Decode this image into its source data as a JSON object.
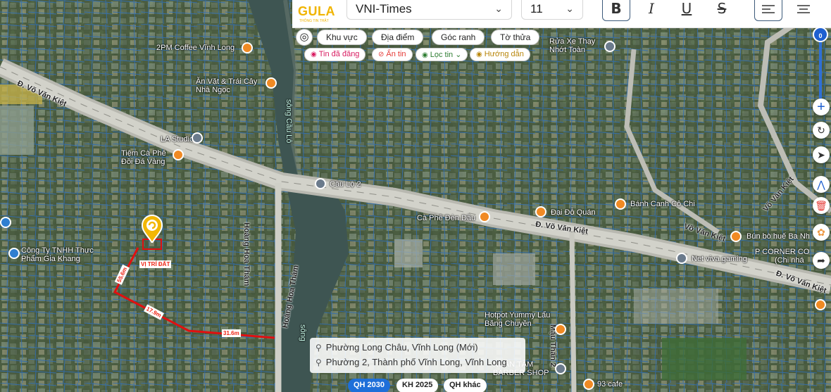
{
  "toolbar": {
    "logo_text": "GULA",
    "logo_sub": "THÔNG TIN THẬT",
    "font_family_value": "VNI-Times",
    "font_size_value": "11",
    "bold_label": "B",
    "italic_label": "I",
    "underline_label": "U",
    "strike_label": "S"
  },
  "map_tabs": [
    "Khu vực",
    "Địa điểm",
    "Góc ranh",
    "Tờ thửa"
  ],
  "filters": [
    {
      "label": "Tin đã đăng",
      "color": "#d81b60"
    },
    {
      "label": "Ẩn tin",
      "color": "#e53935"
    },
    {
      "label": "Lọc tin",
      "color": "#2e7d32"
    },
    {
      "label": "Hướng dẫn",
      "color": "#b8860b"
    }
  ],
  "zoom_label": "0",
  "address": {
    "new": "Phường Long Châu, Vĩnh Long (Mới)",
    "old": "Phường 2, Thành phố Vĩnh Long, Vĩnh Long"
  },
  "plans": [
    "QH 2030",
    "KH 2025",
    "QH khác"
  ],
  "map": {
    "roads": [
      "Đ. Võ Văn Kiệt",
      "Đ. Võ Văn Kiệt",
      "Võ Văn Kiệt",
      "Võ Văn Kiệt",
      "Đ. Võ Văn Kiệt",
      "Hoàng Hoa Thám",
      "Hoàng Hoa Thám",
      "Mậu Thân 2",
      "sông Cầu Lô",
      "sông"
    ],
    "places": [
      "2PM Coffee Vĩnh Long",
      "Ăn Vặt & Trái Cây Nhà Ngọc",
      "LA Studio",
      "Tiệm Cà Phê Đồi Đá Vàng",
      "Công Ty TNHH Thực Phẩm Gia Khang",
      "Cầu Lộ 2",
      "Cà Phê Đèn Dầu",
      "Đại Đỗ Quán",
      "Bánh Canh Cô Chi",
      "Bún bò huế Ba Nh",
      "P CORNER CO",
      "(Chi nhá",
      "Net viva gaming",
      "Rửa Xe Thay Nhớt Toàn",
      "Hotpot Yummy Lẩu Băng Chuyền",
      "NHÂN TÂM BARBER SHOP",
      "93 cafe"
    ],
    "parcel_label": "VỊ TRÍ ĐẤT",
    "dims": [
      "55.6m",
      "17.9m",
      "31.6m"
    ]
  }
}
